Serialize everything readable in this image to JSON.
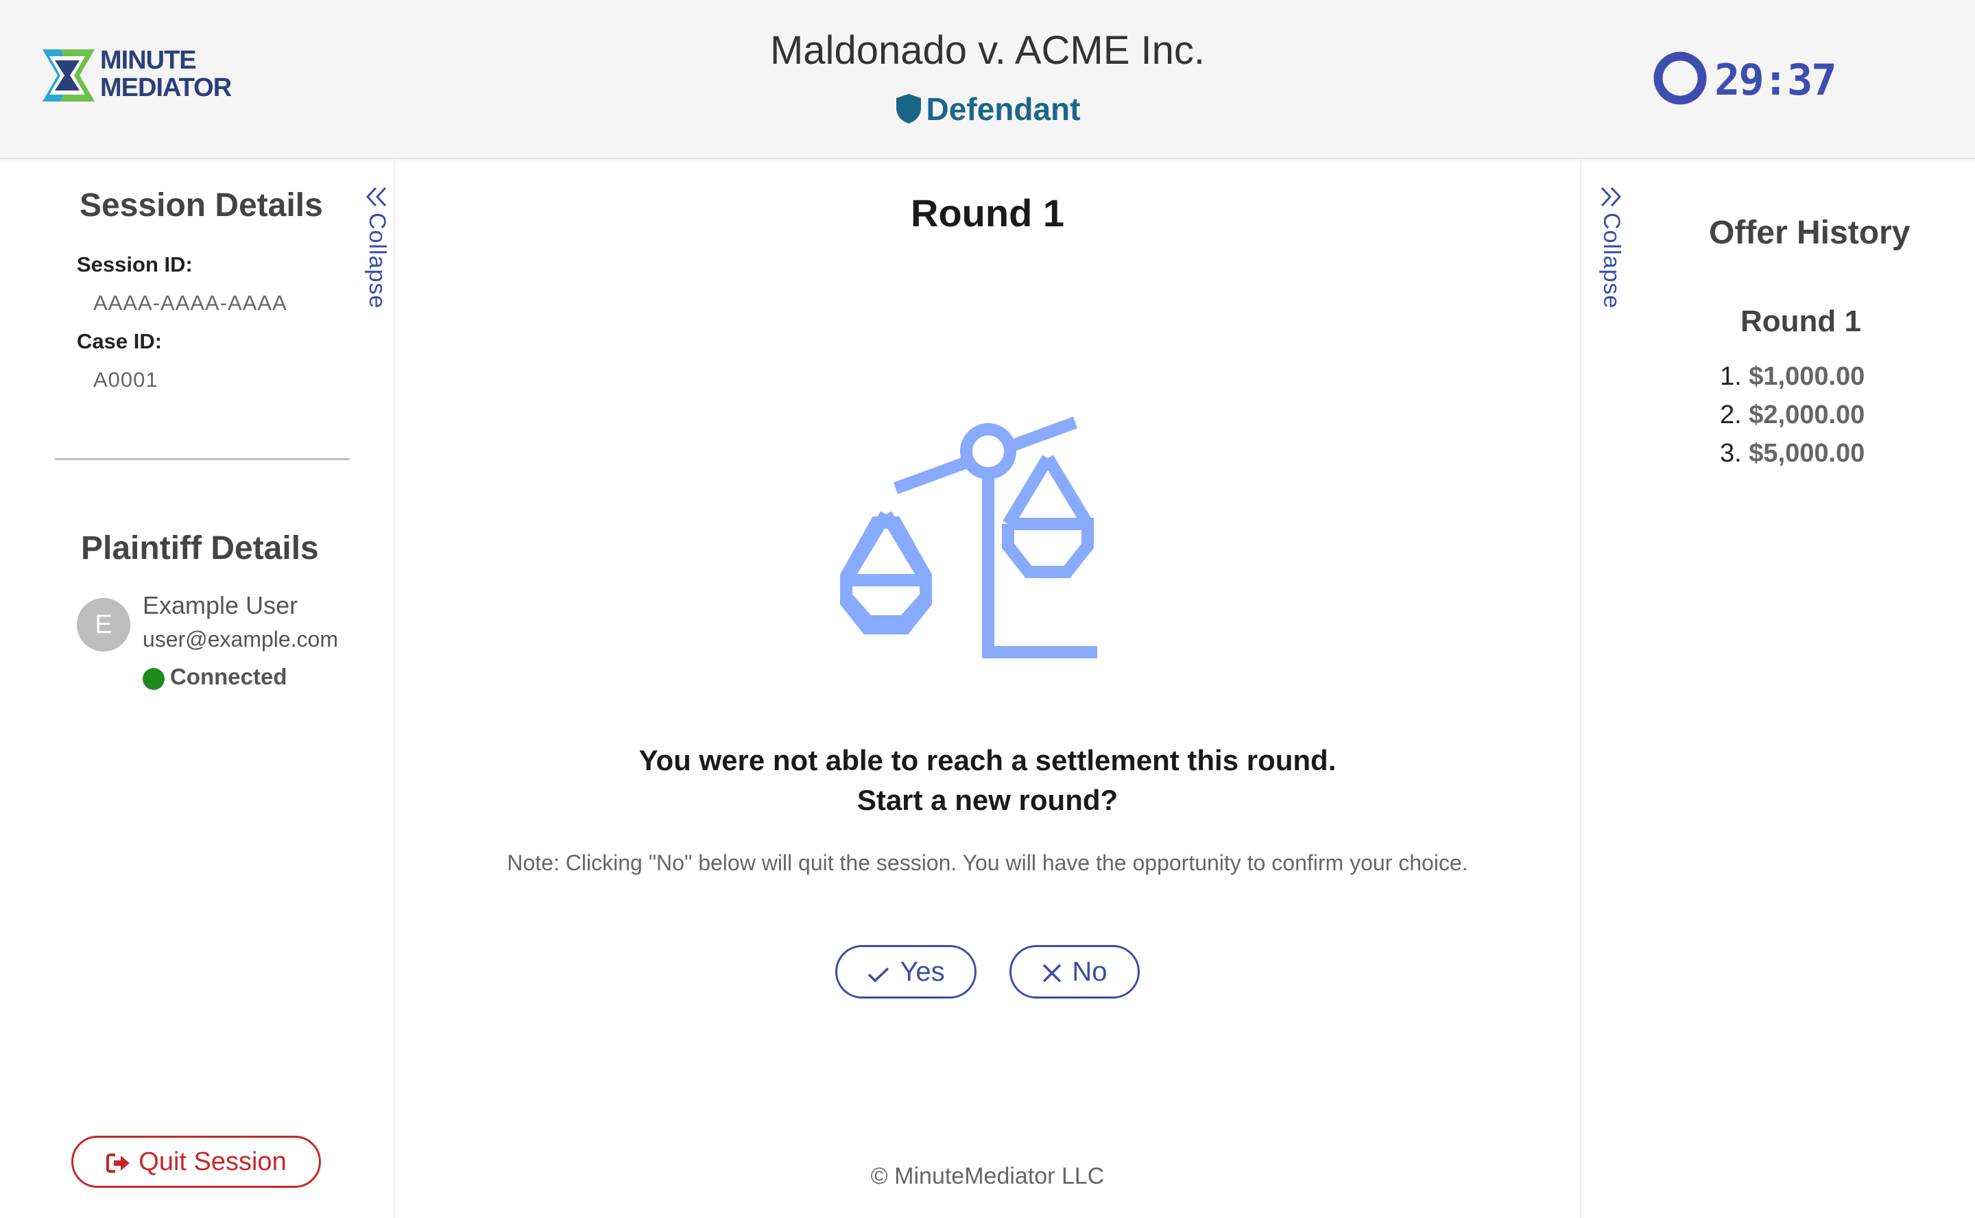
{
  "header": {
    "logo_line1": "MINUTE",
    "logo_line2": "MEDIATOR",
    "case_title": "Maldonado v. ACME Inc.",
    "role": "Defendant",
    "timer": "29:37"
  },
  "left_panel": {
    "session_heading": "Session Details",
    "session_id_label": "Session ID:",
    "session_id_value": "AAAA-AAAA-AAAA",
    "case_id_label": "Case ID:",
    "case_id_value": "A0001",
    "collapse_label": "Collapse",
    "plaintiff_heading": "Plaintiff Details",
    "user": {
      "initial": "E",
      "name": "Example User",
      "email": "user@example.com",
      "status": "Connected"
    },
    "quit_label": "Quit Session"
  },
  "main": {
    "round_title": "Round 1",
    "message_line1": "You were not able to reach a settlement this round.",
    "message_line2": "Start a new round?",
    "note": "Note: Clicking \"No\" below will quit the session. You will have the opportunity to confirm your choice.",
    "yes_label": "Yes",
    "no_label": "No",
    "footer": "© MinuteMediator LLC"
  },
  "right_panel": {
    "collapse_label": "Collapse",
    "heading": "Offer History",
    "round_heading": "Round 1",
    "offers": [
      {
        "num": "1.",
        "amount": "$1,000.00"
      },
      {
        "num": "2.",
        "amount": "$2,000.00"
      },
      {
        "num": "3.",
        "amount": "$5,000.00"
      }
    ]
  },
  "colors": {
    "accent": "#3b4ea8",
    "role": "#1b6688",
    "danger": "#c62828",
    "connected": "#1e8a1e",
    "scales": "#88aaff"
  }
}
